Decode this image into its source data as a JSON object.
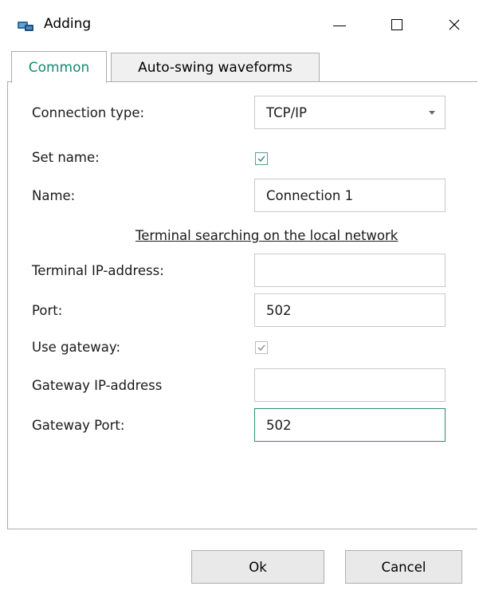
{
  "window": {
    "title": "Adding",
    "icon": "network-connection-icon",
    "controls": [
      "minimize",
      "maximize",
      "close"
    ]
  },
  "tabs": [
    {
      "label": "Common",
      "active": true
    },
    {
      "label": "Auto-swing waveforms",
      "active": false
    }
  ],
  "form": {
    "connection_type": {
      "label": "Connection type:",
      "value": "TCP/IP"
    },
    "set_name": {
      "label": "Set name:",
      "checked": true
    },
    "name": {
      "label": "Name:",
      "value": "Connection 1"
    },
    "search_link": "Terminal searching on the local network",
    "terminal_ip": {
      "label": "Terminal IP-address:",
      "value": ""
    },
    "port": {
      "label": "Port:",
      "value": "502"
    },
    "use_gateway": {
      "label": "Use gateway:",
      "checked": true,
      "disabled": true
    },
    "gateway_ip": {
      "label": "Gateway IP-address",
      "value": ""
    },
    "gateway_port": {
      "label": "Gateway Port:",
      "value": "502"
    }
  },
  "buttons": {
    "ok": "Ok",
    "cancel": "Cancel"
  },
  "colors": {
    "accent": "#138a72",
    "focus_border": "#2e8b72",
    "button_bg": "#e9e9e9"
  }
}
